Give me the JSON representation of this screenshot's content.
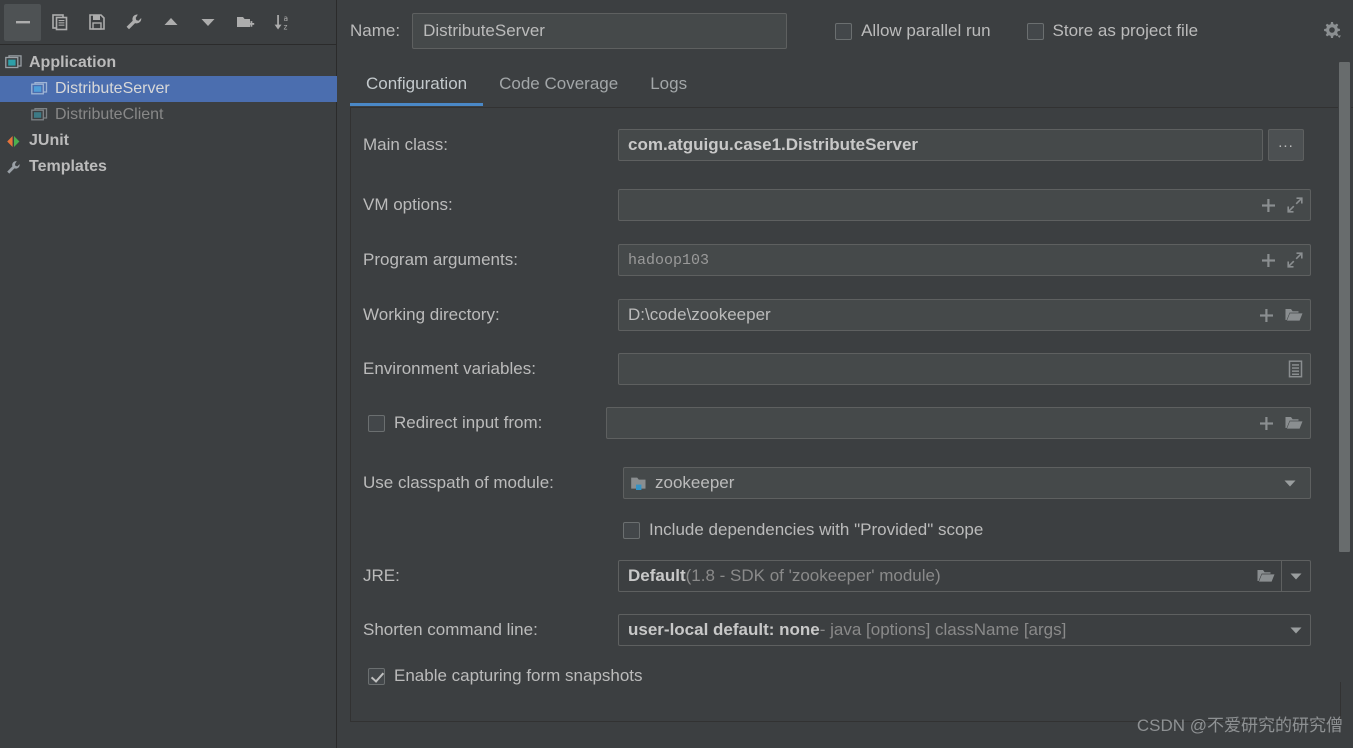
{
  "toolbar": {
    "buttons": [
      {
        "name": "remove-configuration-button",
        "icon": "minus-icon",
        "label": "Remove"
      },
      {
        "name": "copy-configuration-button",
        "icon": "copy-icon",
        "label": "Copy"
      },
      {
        "name": "save-configuration-button",
        "icon": "save-icon",
        "label": "Save"
      },
      {
        "name": "edit-templates-button",
        "icon": "wrench-icon",
        "label": "Edit Templates"
      },
      {
        "name": "move-up-button",
        "icon": "arrow-up-icon",
        "label": "Move Up"
      },
      {
        "name": "move-down-button",
        "icon": "arrow-down-icon",
        "label": "Move Down"
      },
      {
        "name": "new-folder-button",
        "icon": "folder-plus-icon",
        "label": "New Folder"
      },
      {
        "name": "sort-alphabetically-button",
        "icon": "sort-az-icon",
        "label": "Sort Configurations"
      }
    ]
  },
  "sidebar": {
    "tree": [
      {
        "label": "Application",
        "level": 0,
        "icon": "application-icon",
        "selected": false,
        "dimmed": false
      },
      {
        "label": "DistributeServer",
        "level": 1,
        "icon": "run-config-icon",
        "selected": true,
        "dimmed": false
      },
      {
        "label": "DistributeClient",
        "level": 1,
        "icon": "run-config-icon",
        "selected": false,
        "dimmed": true
      },
      {
        "label": "JUnit",
        "level": 0,
        "icon": "junit-icon",
        "selected": false,
        "dimmed": false
      },
      {
        "label": "Templates",
        "level": 0,
        "icon": "wrench-icon",
        "selected": false,
        "dimmed": false
      }
    ]
  },
  "header": {
    "name_label": "Name:",
    "name_value": "DistributeServer",
    "allow_parallel_run": {
      "label": "Allow parallel run",
      "checked": false
    },
    "store_as_project_file": {
      "label": "Store as project file",
      "checked": false
    },
    "gear_icon": "gear-dropdown-icon"
  },
  "tabs": [
    {
      "label": "Configuration",
      "active": true
    },
    {
      "label": "Code Coverage",
      "active": false
    },
    {
      "label": "Logs",
      "active": false
    }
  ],
  "form": {
    "main_class": {
      "label": "Main class:",
      "value": "com.atguigu.case1.DistributeServer",
      "browse_button": "..."
    },
    "vm_options": {
      "label": "VM options:",
      "value": ""
    },
    "program_arguments": {
      "label": "Program arguments:",
      "value": "hadoop103"
    },
    "working_directory": {
      "label": "Working directory:",
      "value": "D:\\code\\zookeeper"
    },
    "environment_variables": {
      "label": "Environment variables:",
      "value": ""
    },
    "redirect_input": {
      "label": "Redirect input from:",
      "checked": false,
      "value": ""
    },
    "classpath_module": {
      "label": "Use classpath of module:",
      "value": "zookeeper",
      "icon": "module-icon"
    },
    "include_provided": {
      "label": "Include dependencies with \"Provided\" scope",
      "checked": false
    },
    "jre": {
      "label": "JRE:",
      "value_bold": "Default",
      "value_grey": " (1.8 - SDK of 'zookeeper' module)"
    },
    "shorten_command_line": {
      "label": "Shorten command line:",
      "value_bold": "user-local default: none",
      "value_grey": " - java [options] className [args]"
    },
    "enable_snapshots": {
      "label": "Enable capturing form snapshots",
      "checked": true
    }
  },
  "watermark": "CSDN @不爱研究的研究僧",
  "colors": {
    "background": "#3c3f41",
    "field_background": "#45494a",
    "selection": "#4b6eaf",
    "accent": "#4a88c7",
    "text": "#bbbbbb",
    "text_dim": "#888888",
    "border": "#5e6060"
  }
}
